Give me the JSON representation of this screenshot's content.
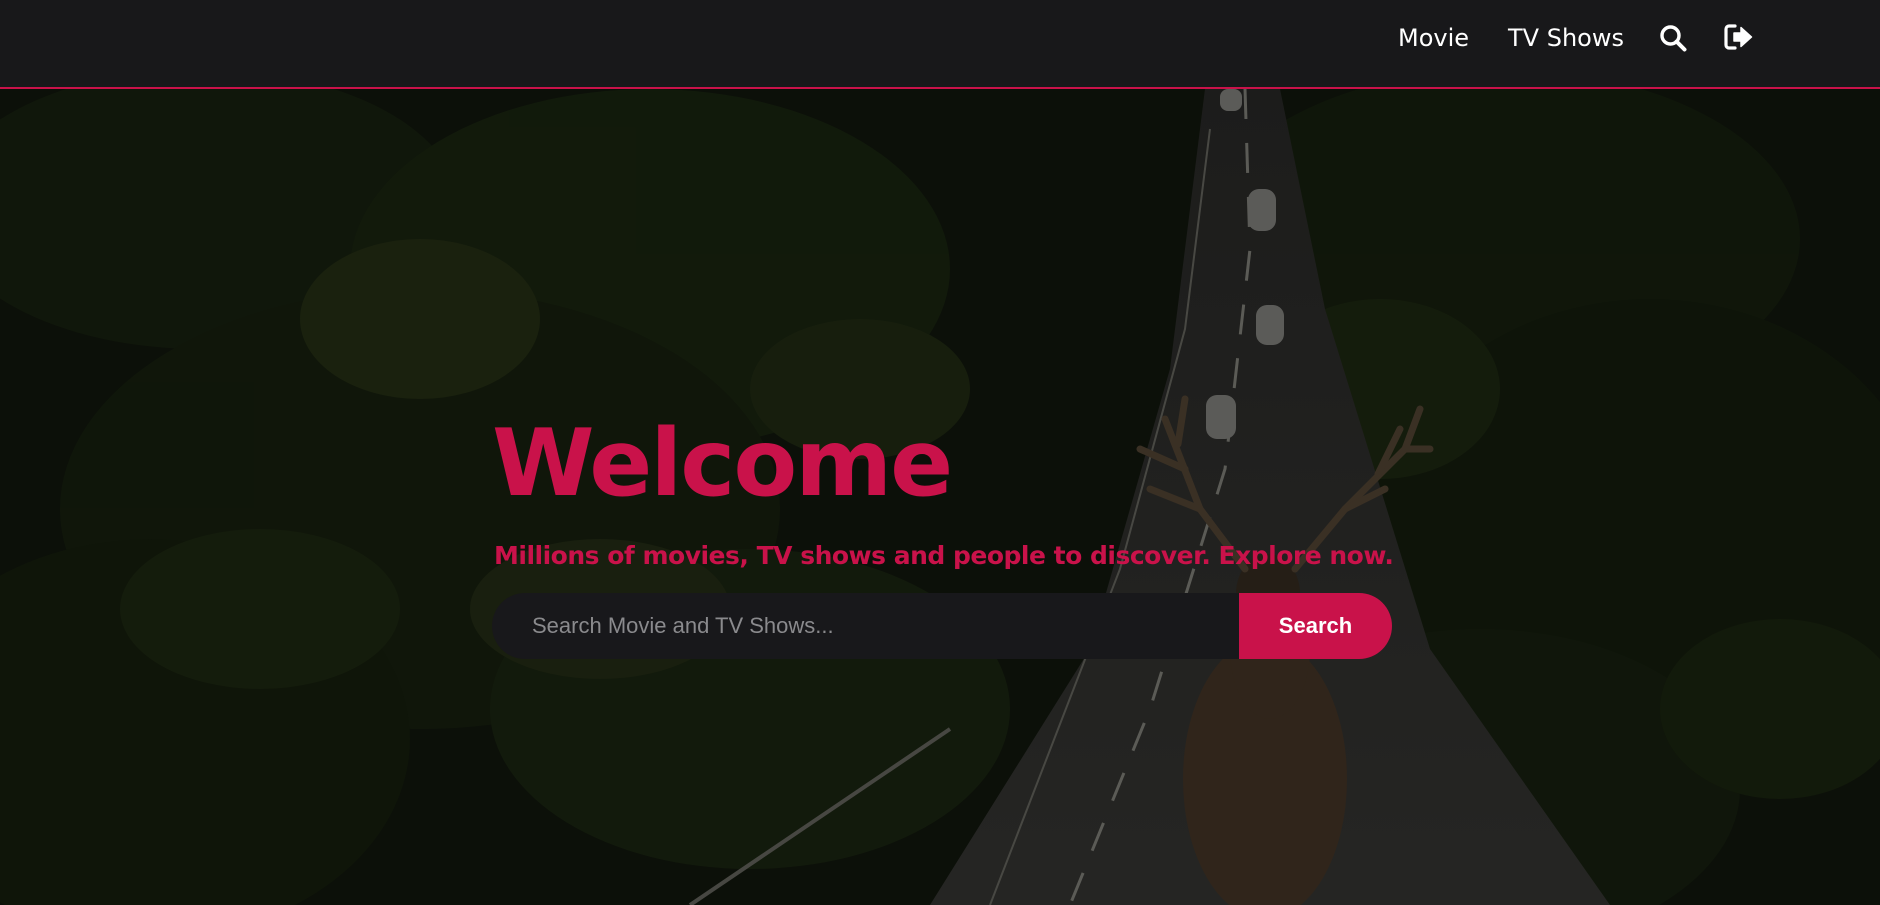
{
  "nav": {
    "movie_label": "Movie",
    "tv_label": "TV Shows",
    "search_icon": "search-icon",
    "logout_icon": "logout-icon"
  },
  "hero": {
    "title": "Welcome",
    "subtitle": "Millions of movies, TV shows and people to discover. Explore now.",
    "search_placeholder": "Search Movie and TV Shows...",
    "search_value": "",
    "search_button": "Search"
  },
  "colors": {
    "accent": "#c9124a",
    "header_bg": "#18181a",
    "input_bg": "#18181b"
  }
}
